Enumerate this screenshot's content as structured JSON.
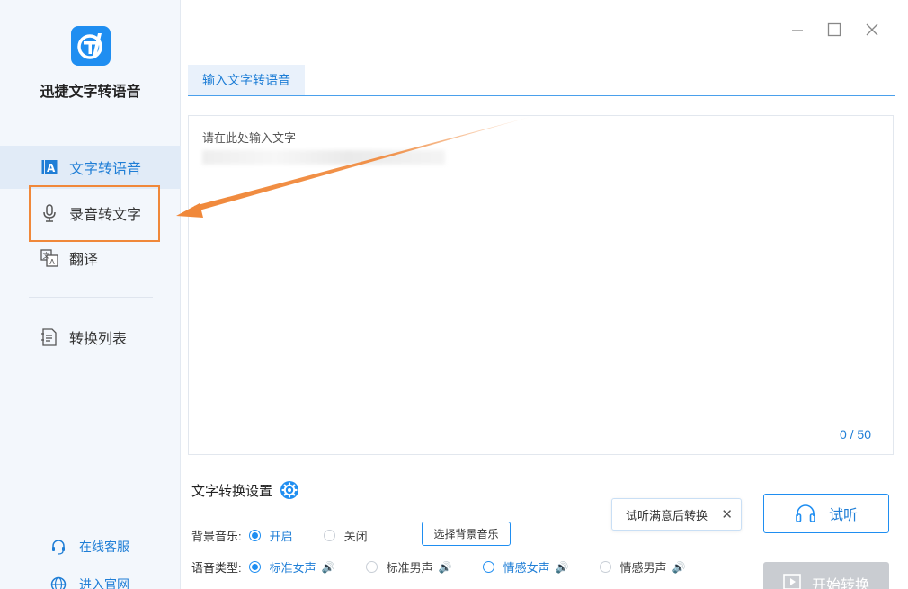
{
  "app": {
    "name": "迅捷文字转语音"
  },
  "sidebar": {
    "items": [
      {
        "label": "文字转语音",
        "icon": "text-a-icon",
        "active": true
      },
      {
        "label": "录音转文字",
        "icon": "microphone-icon",
        "active": false
      },
      {
        "label": "翻译",
        "icon": "translate-icon",
        "active": false
      },
      {
        "label": "转换列表",
        "icon": "file-list-icon",
        "active": false
      }
    ],
    "footer": [
      {
        "label": "在线客服",
        "icon": "headset-icon"
      },
      {
        "label": "进入官网",
        "icon": "globe-icon"
      }
    ]
  },
  "tabs": [
    {
      "label": "输入文字转语音",
      "active": true
    }
  ],
  "editor": {
    "placeholder": "请在此处输入文字",
    "counter": "0 / 50"
  },
  "settings": {
    "title": "文字转换设置",
    "bgm": {
      "label": "背景音乐:",
      "options": [
        "开启",
        "关闭"
      ],
      "selected": "开启",
      "button": "选择背景音乐"
    },
    "voice": {
      "label": "语音类型:",
      "options": [
        "标准女声",
        "标准男声",
        "情感女声",
        "情感男声"
      ],
      "selected": "标准女声"
    }
  },
  "tooltip": {
    "text": "试听满意后转换"
  },
  "buttons": {
    "listen": "试听",
    "start": "开始转换"
  },
  "colors": {
    "accent": "#1f8ef1",
    "annotation": "#f0883a",
    "sidebar_bg": "#f3f7fc"
  }
}
